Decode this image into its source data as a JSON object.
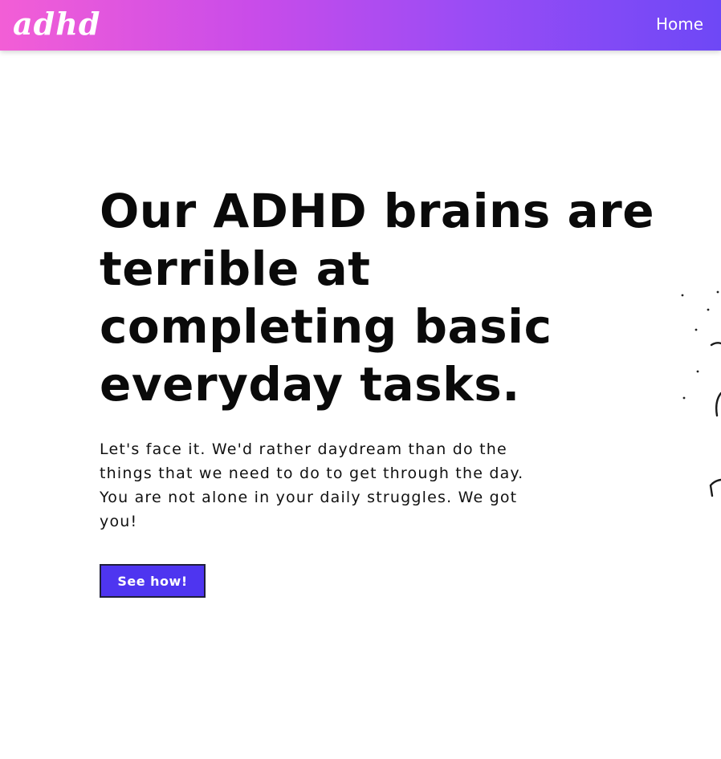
{
  "header": {
    "logo": "adhd",
    "nav_home": "Home"
  },
  "hero": {
    "title": "Our ADHD brains are terrible at completing basic everyday tasks.",
    "description": "Let's face it. We'd rather daydream than do the things that we need to do to get through the day. You are not alone in your daily struggles. We got you!",
    "cta_label": "See how!"
  },
  "colors": {
    "gradient_start": "#f35ed6",
    "gradient_end": "#6e48f6",
    "button_bg": "#4e35f0",
    "title_text": "#0a0a0a"
  }
}
